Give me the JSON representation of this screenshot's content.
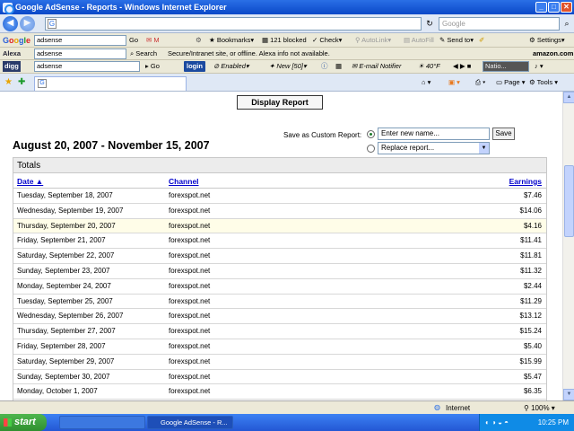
{
  "window": {
    "title": "Google AdSense - Reports - Windows Internet Explorer"
  },
  "address_bar": {
    "search_placeholder": "Google"
  },
  "google_toolbar": {
    "search_value": "adsense",
    "go_label": "Go",
    "bookmarks_label": "Bookmarks",
    "blocked_label": "121 blocked",
    "check_label": "Check",
    "autolink_label": "AutoLink",
    "autofill_label": "AutoFill",
    "sendto_label": "Send to",
    "settings_label": "Settings"
  },
  "alexa_toolbar": {
    "logo": "Alexa",
    "search_value": "adsense",
    "search_label": "Search",
    "status_text": "Secure/Intranet site, or offline. Alexa info not available.",
    "amazon_label": "amazon.com"
  },
  "digg_toolbar": {
    "logo": "digg",
    "search_value": "adsense",
    "go_label": "Go",
    "login_label": "login",
    "enabled_label": "Enabled",
    "new_label": "New [50]",
    "email_label": "E-mail Notifier",
    "weather_label": "40°F",
    "media_label": "Natio..."
  },
  "command_bar": {
    "page_label": "Page",
    "tools_label": "Tools"
  },
  "report": {
    "display_button": "Display Report",
    "date_range": "August 20, 2007 - November 15, 2007",
    "custom_report_label": "Save as Custom Report:",
    "new_name_placeholder": "Enter new name...",
    "save_button": "Save",
    "replace_label": "Replace report...",
    "totals_label": "Totals",
    "columns": {
      "date": "Date",
      "channel": "Channel",
      "earnings": "Earnings"
    },
    "rows": [
      {
        "date": "Tuesday, September 18, 2007",
        "channel": "forexspot.net",
        "earnings": "$7.46"
      },
      {
        "date": "Wednesday, September 19, 2007",
        "channel": "forexspot.net",
        "earnings": "$14.06"
      },
      {
        "date": "Thursday, September 20, 2007",
        "channel": "forexspot.net",
        "earnings": "$4.16"
      },
      {
        "date": "Friday, September 21, 2007",
        "channel": "forexspot.net",
        "earnings": "$11.41"
      },
      {
        "date": "Saturday, September 22, 2007",
        "channel": "forexspot.net",
        "earnings": "$11.81"
      },
      {
        "date": "Sunday, September 23, 2007",
        "channel": "forexspot.net",
        "earnings": "$11.32"
      },
      {
        "date": "Monday, September 24, 2007",
        "channel": "forexspot.net",
        "earnings": "$2.44"
      },
      {
        "date": "Tuesday, September 25, 2007",
        "channel": "forexspot.net",
        "earnings": "$11.29"
      },
      {
        "date": "Wednesday, September 26, 2007",
        "channel": "forexspot.net",
        "earnings": "$13.12"
      },
      {
        "date": "Thursday, September 27, 2007",
        "channel": "forexspot.net",
        "earnings": "$15.24"
      },
      {
        "date": "Friday, September 28, 2007",
        "channel": "forexspot.net",
        "earnings": "$5.40"
      },
      {
        "date": "Saturday, September 29, 2007",
        "channel": "forexspot.net",
        "earnings": "$15.99"
      },
      {
        "date": "Sunday, September 30, 2007",
        "channel": "forexspot.net",
        "earnings": "$5.47"
      },
      {
        "date": "Monday, October 1, 2007",
        "channel": "forexspot.net",
        "earnings": "$6.35"
      }
    ]
  },
  "status_bar": {
    "zone": "Internet",
    "zoom": "100%"
  },
  "taskbar": {
    "start_label": "start",
    "task_label": "Google AdSense - R...",
    "clock": "10:25 PM"
  },
  "colors": {
    "title_bar": "#0a48c8",
    "link_blue": "#0000cc",
    "highlight_row": "#fffde8"
  }
}
